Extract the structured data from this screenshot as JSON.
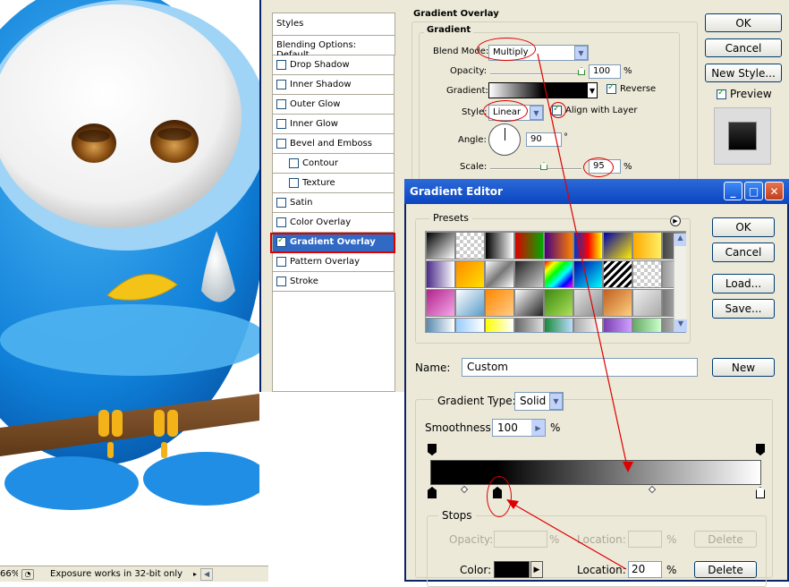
{
  "status_bar": {
    "zoom": "66%",
    "message": "Exposure works in 32-bit only"
  },
  "layer_style": {
    "styles_header": "Styles",
    "blending_options": "Blending Options: Default",
    "items": [
      {
        "label": "Drop Shadow",
        "checked": false
      },
      {
        "label": "Inner Shadow",
        "checked": false
      },
      {
        "label": "Outer Glow",
        "checked": false
      },
      {
        "label": "Inner Glow",
        "checked": false
      },
      {
        "label": "Bevel and Emboss",
        "checked": false
      },
      {
        "label": "Contour",
        "checked": false
      },
      {
        "label": "Texture",
        "checked": false
      },
      {
        "label": "Satin",
        "checked": false
      },
      {
        "label": "Color Overlay",
        "checked": false
      },
      {
        "label": "Gradient Overlay",
        "checked": true
      },
      {
        "label": "Pattern Overlay",
        "checked": false
      },
      {
        "label": "Stroke",
        "checked": false
      }
    ],
    "section_title": "Gradient Overlay",
    "group_title": "Gradient",
    "blend_mode_label": "Blend Mode:",
    "blend_mode": "Multiply",
    "opacity_label": "Opacity:",
    "opacity": "100",
    "opacity_unit": "%",
    "gradient_label": "Gradient:",
    "reverse_label": "Reverse",
    "style_label": "Style:",
    "style": "Linear",
    "align_label": "Align with Layer",
    "angle_label": "Angle:",
    "angle": "90",
    "angle_unit": "°",
    "scale_label": "Scale:",
    "scale": "95",
    "scale_unit": "%",
    "ok": "OK",
    "cancel": "Cancel",
    "new_style": "New Style...",
    "preview_label": "Preview"
  },
  "gradient_editor": {
    "title": "Gradient Editor",
    "presets_label": "Presets",
    "ok": "OK",
    "cancel": "Cancel",
    "load": "Load...",
    "save": "Save...",
    "name_label": "Name:",
    "name_value": "Custom",
    "new_button": "New",
    "gradient_type_label": "Gradient Type:",
    "gradient_type": "Solid",
    "smoothness_label": "Smoothness:",
    "smoothness": "100",
    "smoothness_unit": "%",
    "stops_label": "Stops",
    "opacity_label": "Opacity:",
    "opacity_unit": "%",
    "location_label": "Location:",
    "location_unit": "%",
    "delete": "Delete",
    "color_label": "Color:",
    "location_value": "20",
    "location_unit2": "%",
    "delete2": "Delete",
    "window_controls": [
      "minimize-icon",
      "maximize-icon",
      "close-icon"
    ]
  },
  "colors": {
    "accent_selection": "#316ac5",
    "annotation": "#dd0000",
    "title_bar": "#0a45c0"
  }
}
